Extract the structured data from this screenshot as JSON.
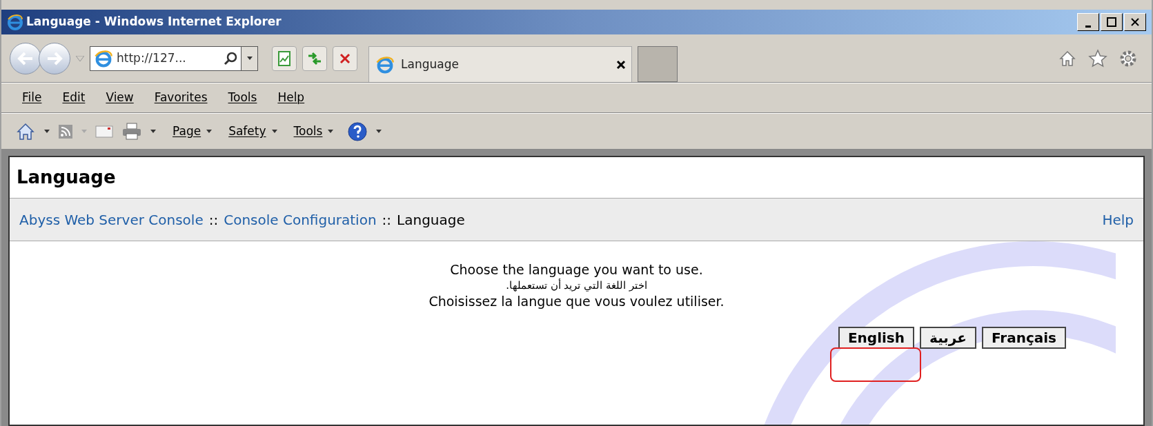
{
  "window": {
    "title": "Language - Windows Internet Explorer"
  },
  "address_bar": {
    "value": "http://127..."
  },
  "tabs": [
    {
      "label": "Language",
      "selected": true
    }
  ],
  "menu": [
    "File",
    "Edit",
    "View",
    "Favorites",
    "Tools",
    "Help"
  ],
  "command_bar": [
    "Page",
    "Safety",
    "Tools"
  ],
  "page": {
    "heading": "Language",
    "breadcrumb": [
      {
        "label": "Abyss Web Server Console",
        "kind": "link"
      },
      {
        "label": "::",
        "kind": "sep"
      },
      {
        "label": "Console Configuration",
        "kind": "link"
      },
      {
        "label": "::",
        "kind": "sep"
      },
      {
        "label": "Language",
        "kind": "text"
      }
    ],
    "help": "Help",
    "prompts": [
      {
        "text": "Choose the language you want to use.",
        "kind": "latin"
      },
      {
        "text": "اختر اللغة التي تريد أن تستعملها.",
        "kind": "arabic"
      },
      {
        "text": "Choisissez la langue que vous voulez utiliser.",
        "kind": "latin"
      }
    ],
    "buttons": [
      {
        "label": "English",
        "highlighted": true
      },
      {
        "label": "عربية",
        "highlighted": false
      },
      {
        "label": "Français",
        "highlighted": false
      }
    ]
  }
}
